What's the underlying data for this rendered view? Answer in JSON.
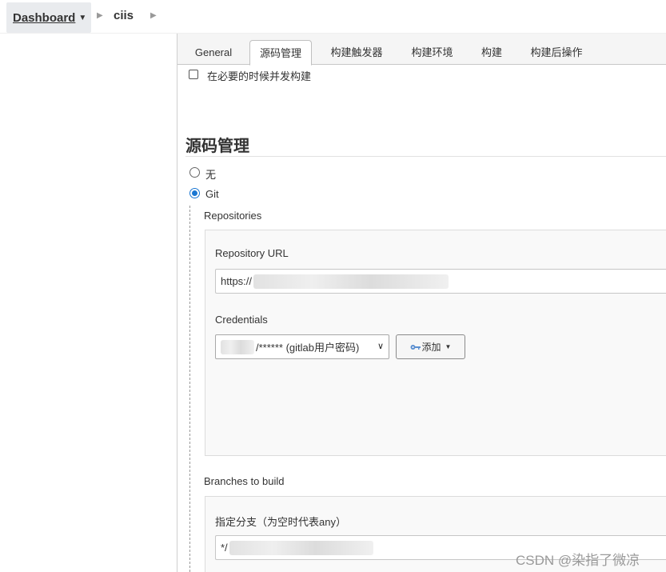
{
  "breadcrumb": {
    "dashboard": "Dashboard",
    "job": "ciis"
  },
  "tabs": [
    {
      "label": "General",
      "active": false
    },
    {
      "label": "源码管理",
      "active": true
    },
    {
      "label": "构建触发器",
      "active": false
    },
    {
      "label": "构建环境",
      "active": false
    },
    {
      "label": "构建",
      "active": false
    },
    {
      "label": "构建后操作",
      "active": false
    }
  ],
  "options": {
    "concurrent_build_label": "在必要的时候并发构建",
    "concurrent_build_checked": false
  },
  "scm": {
    "title": "源码管理",
    "none_label": "无",
    "git_label": "Git",
    "selected": "Git",
    "repositories_label": "Repositories",
    "repo_url_label": "Repository URL",
    "repo_url_value": "https://",
    "credentials_label": "Credentials",
    "credentials_value": "/****** (gitlab用户密码)",
    "add_button_label": "添加",
    "branches_label": "Branches to build",
    "branch_specifier_label": "指定分支（为空时代表any）",
    "branch_value": "*/"
  },
  "watermark": "CSDN @染指了微凉",
  "colors": {
    "accent": "#1976d2",
    "tab_bar": "#f5f5f5",
    "panel": "#f9f9f9"
  }
}
